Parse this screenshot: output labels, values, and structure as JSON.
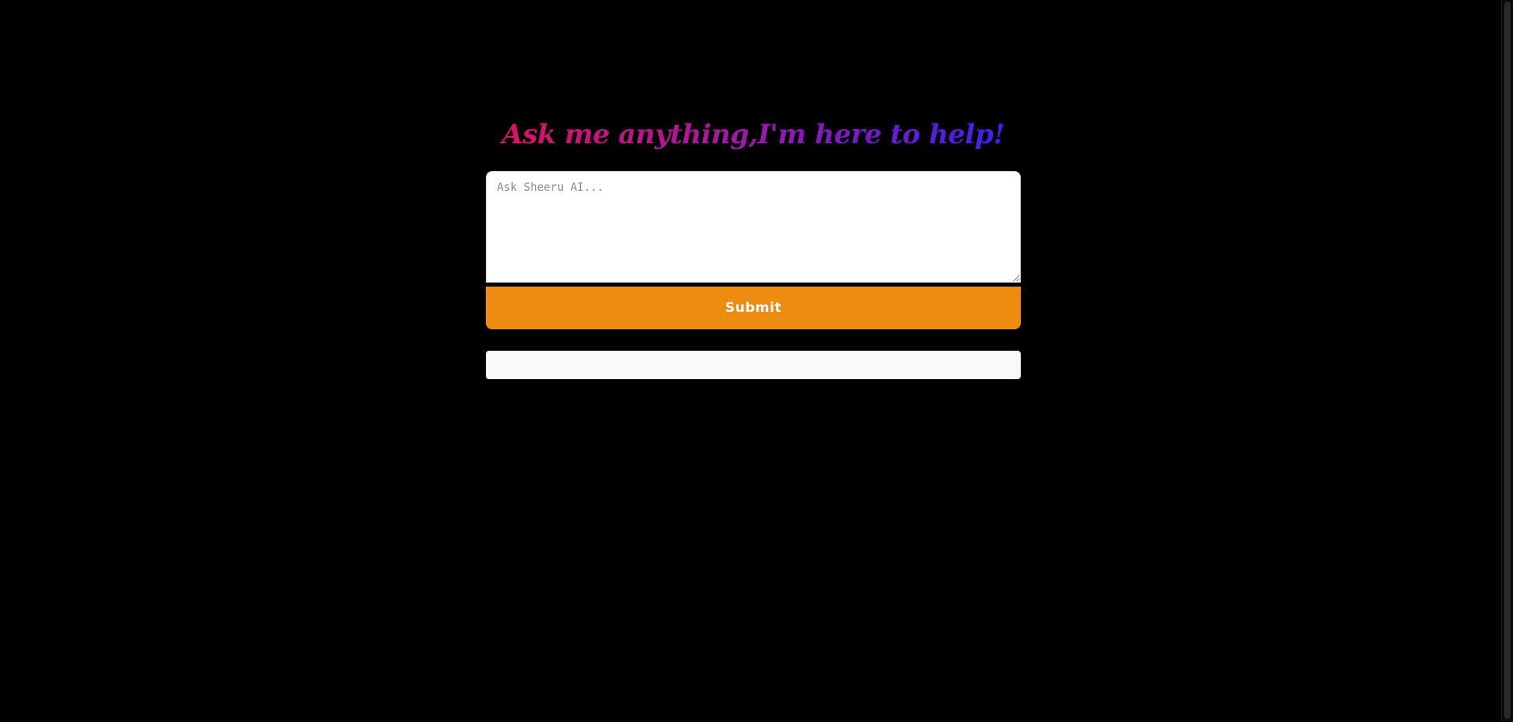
{
  "page": {
    "background": "#000000"
  },
  "header": {
    "title": "Ask me anything,I'm here to help!",
    "gradient_colors": [
      "#e3105f",
      "#a616a6",
      "#3a1ff0"
    ]
  },
  "prompt": {
    "value": "",
    "placeholder": "Ask Sheeru AI..."
  },
  "submit": {
    "label": "Submit",
    "color": "#ee8c12"
  },
  "response": {
    "text": ""
  }
}
